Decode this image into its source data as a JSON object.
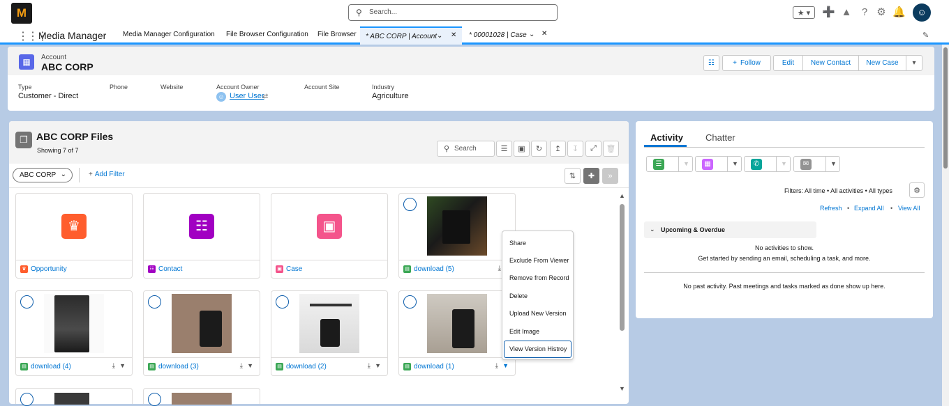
{
  "app": {
    "logo_text": "M",
    "search_placeholder": "Search...",
    "name": "Media Manager",
    "nav_items": [
      "Media Manager Configuration",
      "File Browser Configuration",
      "File Browser"
    ],
    "tabs": [
      {
        "label": "* ABC CORP | Account",
        "active": true
      },
      {
        "label": "* 00001028 | Case",
        "active": false
      }
    ]
  },
  "record": {
    "type_label": "Account",
    "name": "ABC CORP",
    "actions": [
      "Follow",
      "Edit",
      "New Contact",
      "New Case"
    ],
    "fields": [
      {
        "label": "Type",
        "value": "Customer - Direct"
      },
      {
        "label": "Phone",
        "value": ""
      },
      {
        "label": "Website",
        "value": ""
      },
      {
        "label": "Account Owner",
        "value": "User User"
      },
      {
        "label": "Account Site",
        "value": ""
      },
      {
        "label": "Industry",
        "value": "Agriculture"
      }
    ]
  },
  "files": {
    "title": "ABC CORP Files",
    "count": "Showing 7 of 7",
    "search_placeholder": "Search",
    "scope": "ABC CORP",
    "add_filter": "Add Filter",
    "cards": [
      {
        "name": "Opportunity",
        "kind": "folder",
        "color": "#ff5d2d"
      },
      {
        "name": "Contact",
        "kind": "folder",
        "color": "#a100c2"
      },
      {
        "name": "Case",
        "kind": "folder",
        "color": "#f4548b"
      },
      {
        "name": "download (5)",
        "kind": "image",
        "selected": false
      },
      {
        "name": "download (4)",
        "kind": "image",
        "selected": false
      },
      {
        "name": "download (3)",
        "kind": "image",
        "selected": false
      },
      {
        "name": "download (2)",
        "kind": "image",
        "selected": false
      },
      {
        "name": "download (1)",
        "kind": "image",
        "selected": false
      }
    ],
    "context_menu": [
      "Share",
      "Exclude From Viewer",
      "Remove from Record",
      "Delete",
      "Upload New Version",
      "Edit Image",
      "View Version Histroy"
    ]
  },
  "activity": {
    "tabs": [
      "Activity",
      "Chatter"
    ],
    "filters": "Filters: All time • All activities • All types",
    "links": [
      "Refresh",
      "Expand All",
      "View All"
    ],
    "upcoming_title": "Upcoming & Overdue",
    "no_activities": "No activities to show.",
    "get_started": "Get started by sending an email, scheduling a task, and more.",
    "past_activity": "No past activity. Past meetings and tasks marked as done show up here."
  }
}
